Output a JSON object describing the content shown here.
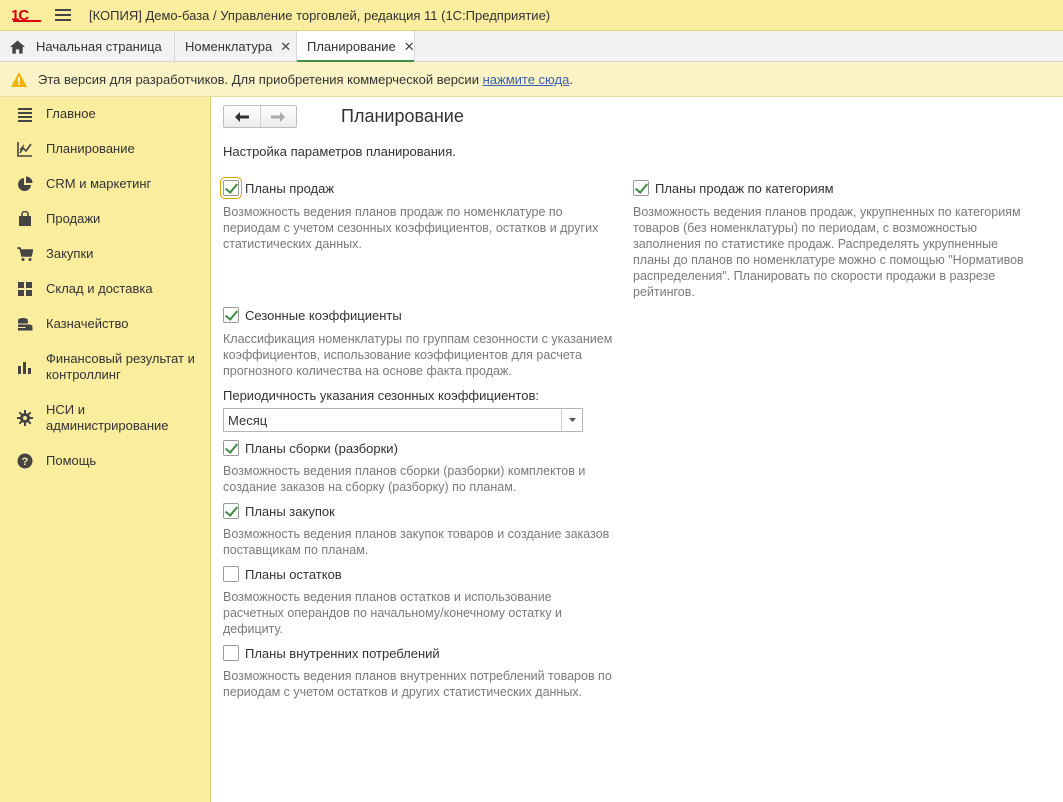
{
  "app": {
    "logo_text": "1С",
    "window_title": "[КОПИЯ] Демо-база / Управление торговлей, редакция 11  (1С:Предприятие)"
  },
  "tabs": [
    {
      "label": "Начальная страница",
      "icon": "home-icon",
      "closable": false,
      "active": false
    },
    {
      "label": "Номенклатура",
      "closable": true,
      "active": false
    },
    {
      "label": "Планирование",
      "closable": true,
      "active": true
    }
  ],
  "close_glyph": "✕",
  "warning": {
    "text": "Эта версия для разработчиков. Для приобретения коммерческой версии ",
    "link": "нажмите сюда",
    "suffix": ".",
    "icon": "warning-icon"
  },
  "sidebar": {
    "items": [
      {
        "label": "Главное",
        "icon": "list-icon"
      },
      {
        "label": "Планирование",
        "icon": "planning-chart-icon"
      },
      {
        "label": "CRM и маркетинг",
        "icon": "pie-chart-icon"
      },
      {
        "label": "Продажи",
        "icon": "shopping-bag-icon"
      },
      {
        "label": "Закупки",
        "icon": "cart-icon"
      },
      {
        "label": "Склад и доставка",
        "icon": "grid-icon"
      },
      {
        "label": "Казначейство",
        "icon": "coins-icon"
      },
      {
        "label": "Финансовый результат и контроллинг",
        "icon": "bar-chart-icon"
      },
      {
        "label": "НСИ и администрирование",
        "icon": "gear-icon"
      },
      {
        "label": "Помощь",
        "icon": "help-icon"
      }
    ]
  },
  "page": {
    "title": "Планирование",
    "intro": "Настройка параметров планирования.",
    "left_options": [
      {
        "label": "Планы продаж",
        "checked": true,
        "description": "Возможность ведения планов продаж по номенклатуре по периодам с учетом сезонных коэффициентов, остатков и других статистических данных."
      },
      {
        "label": "Сезонные коэффициенты",
        "checked": true,
        "description": "Классификация номенклатуры по группам сезонности с указанием коэффициентов, использование коэффициентов для расчета прогнозного количества на основе факта продаж."
      },
      {
        "label": "Планы сборки (разборки)",
        "checked": true,
        "description": "Возможность ведения планов сборки (разборки) комплектов и создание заказов на сборку (разборку) по планам."
      },
      {
        "label": "Планы закупок",
        "checked": true,
        "description": "Возможность ведения планов закупок товаров и создание заказов поставщикам по планам."
      },
      {
        "label": "Планы остатков",
        "checked": false,
        "description": "Возможность ведения планов остатков и использование расчетных операндов по начальному/конечному остатку и дефициту."
      },
      {
        "label": "Планы внутренних потреблений",
        "checked": false,
        "description": "Возможность ведения планов внутренних потреблений товаров по периодам с учетом остатков и других статистических данных."
      }
    ],
    "right_options": [
      {
        "label": "Планы продаж по категориям",
        "checked": true,
        "description": "Возможность ведения планов продаж, укрупненных по категориям товаров (без номенклатуры) по периодам, с возможностью заполнения по статистике продаж. Распределять укрупненные планы до планов по номенклатуре можно с помощью \"Нормативов распределения\". Планировать по скорости продажи в разрезе рейтингов."
      }
    ],
    "seasonality": {
      "label": "Периодичность указания сезонных коэффициентов:",
      "value": "Месяц"
    }
  },
  "colors": {
    "accent_green": "#3f8c43",
    "sidebar_bg": "#fbed9e",
    "link_blue": "#3a5db5",
    "logo_red": "#d8000e"
  }
}
